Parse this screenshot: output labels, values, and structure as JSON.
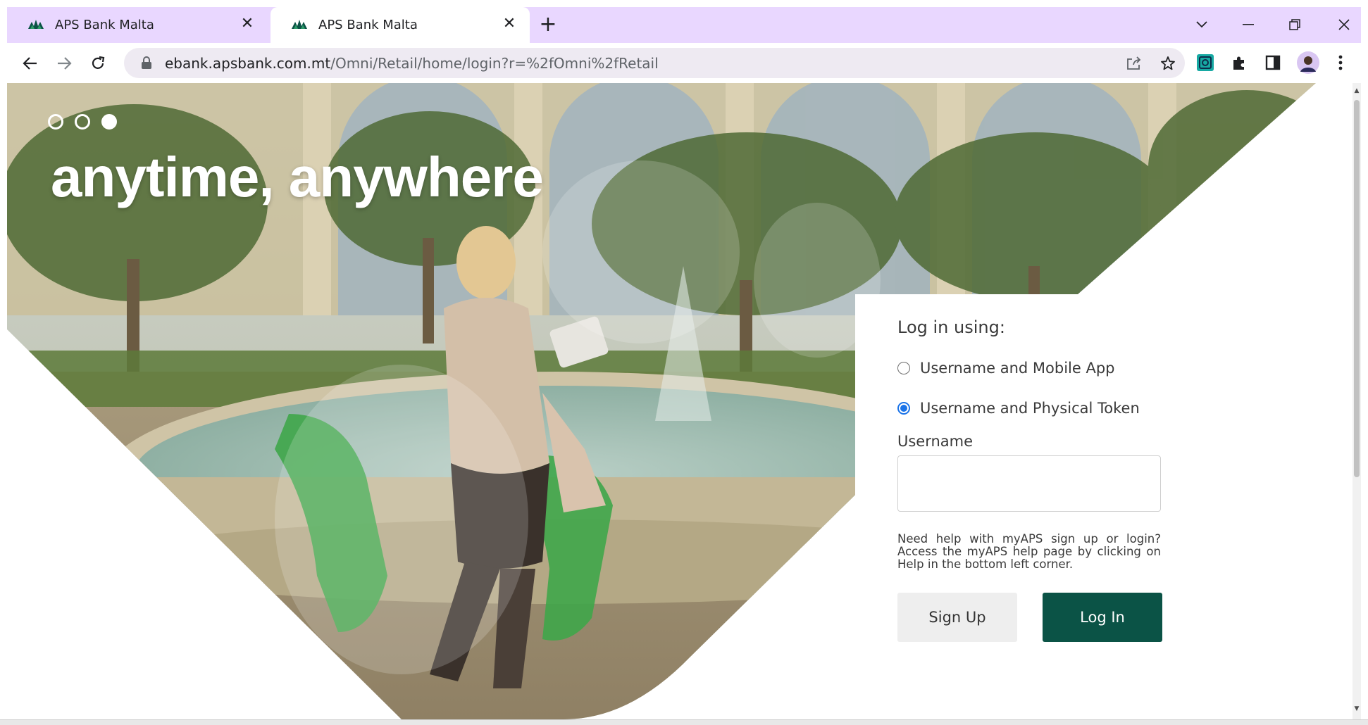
{
  "browser": {
    "tabs": [
      {
        "title": "APS Bank Malta",
        "active": false
      },
      {
        "title": "APS Bank Malta",
        "active": true
      }
    ],
    "url_host": "ebank.apsbank.com.mt",
    "url_path": "/Omni/Retail/home/login?r=%2fOmni%2fRetail",
    "tab_close_glyph": "✕",
    "new_tab_glyph": "+",
    "icons": [
      "back-arrow-icon",
      "forward-arrow-icon",
      "reload-icon",
      "lock-icon",
      "share-icon",
      "star-icon",
      "extension-icon",
      "puzzle-icon",
      "side-panel-icon",
      "profile-avatar",
      "kebab-menu-icon",
      "tab-search-icon",
      "minimize-icon",
      "restore-icon",
      "close-window-icon"
    ]
  },
  "hero": {
    "title": "anytime, anywhere",
    "carousel_dots": [
      {
        "active": false
      },
      {
        "active": false
      },
      {
        "active": true
      }
    ]
  },
  "login": {
    "heading": "Log in using:",
    "options": [
      {
        "label": "Username and Mobile App",
        "checked": false
      },
      {
        "label": "Username and Physical Token",
        "checked": true
      }
    ],
    "username_label": "Username",
    "username_value": "",
    "help_text": "Need help with myAPS sign up or login? Access the myAPS help page by clicking on Help in the bottom left corner.",
    "signup_label": "Sign Up",
    "login_label": "Log In"
  },
  "colors": {
    "tabstrip": "#e9d7ff",
    "omnibox": "#eeeaf2",
    "login_button": "#0b5346",
    "signup_button": "#eeeeee",
    "radio_checked": "#1a73e8"
  }
}
